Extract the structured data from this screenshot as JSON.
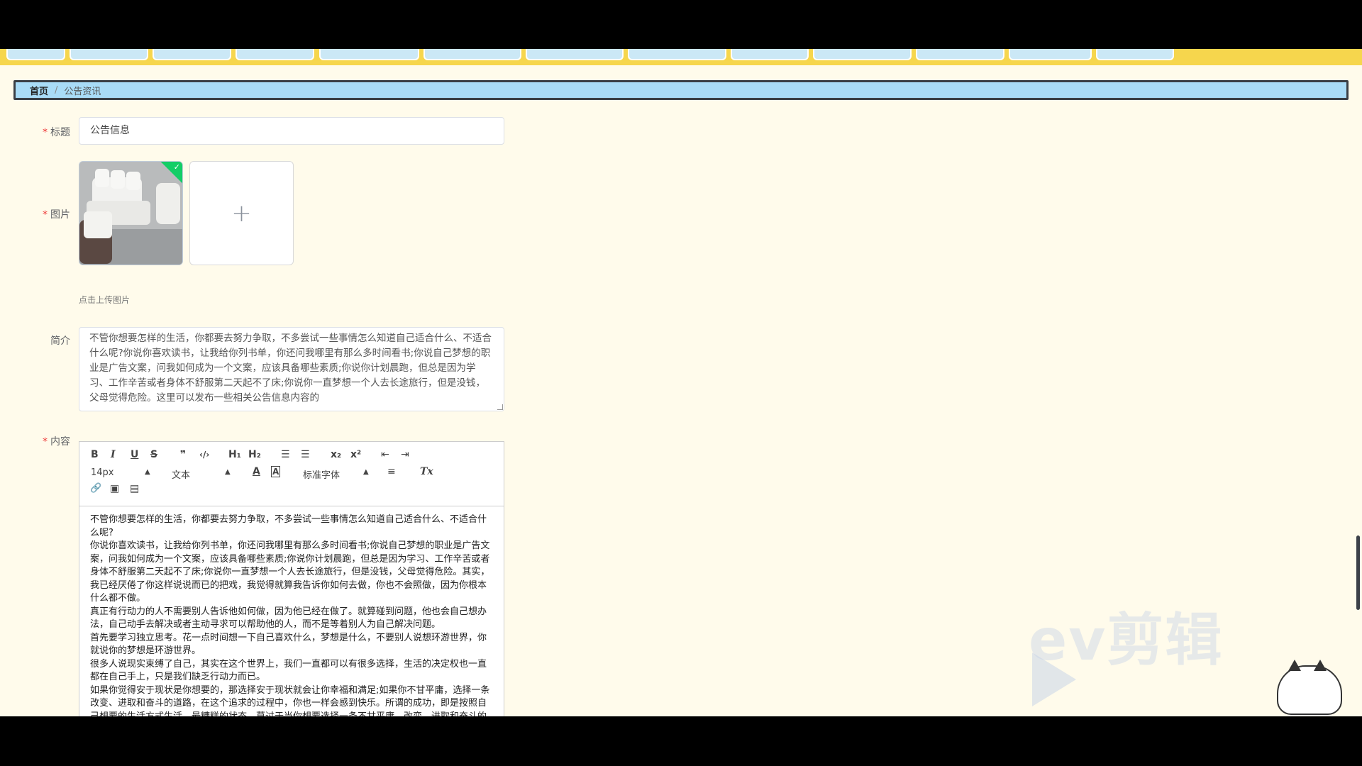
{
  "breadcrumb": {
    "home": "首页",
    "separator": "/",
    "current": "公告资讯"
  },
  "form": {
    "title_label": "标题",
    "title_value": "公告信息",
    "image_label": "图片",
    "upload_tip": "点击上传图片",
    "intro_label": "简介",
    "intro_value": "不管你想要怎样的生活，你都要去努力争取，不多尝试一些事情怎么知道自己适合什么、不适合什么呢?你说你喜欢读书，让我给你列书单，你还问我哪里有那么多时间看书;你说自己梦想的职业是广告文案，问我如何成为一个文案，应该具备哪些素质;你说你计划晨跑，但总是因为学习、工作辛苦或者身体不舒服第二天起不了床;你说你一直梦想一个人去长途旅行，但是没钱，父母觉得危险。这里可以发布一些相关公告信息内容的",
    "content_label": "内容"
  },
  "editor": {
    "toolbar": {
      "bold": "B",
      "italic": "I",
      "underline": "U",
      "strike": "S",
      "quote": "❞",
      "code": "‹/›",
      "h1": "H₁",
      "h2": "H₂",
      "ordered_list": "☰",
      "bullet_list": "☰",
      "sub": "x₂",
      "sup": "x²",
      "outdent": "⇤",
      "indent": "⇥",
      "size": "14px",
      "header": "文本",
      "font": "标准字体",
      "color": "A",
      "background": "A",
      "align": "≡",
      "clean": "Tx",
      "link": "🔗",
      "image": "▣",
      "video": "▤"
    },
    "paragraphs": [
      "不管你想要怎样的生活，你都要去努力争取，不多尝试一些事情怎么知道自己适合什么、不适合什么呢?",
      "你说你喜欢读书，让我给你列书单，你还问我哪里有那么多时间看书;你说自己梦想的职业是广告文案，问我如何成为一个文案，应该具备哪些素质;你说你计划晨跑，但总是因为学习、工作辛苦或者身体不舒服第二天起不了床;你说你一直梦想一个人去长途旅行，但是没钱，父母觉得危险。其实，我已经厌倦了你这样说说而已的把戏，我觉得就算我告诉你如何去做，你也不会照做，因为你根本什么都不做。",
      "真正有行动力的人不需要别人告诉他如何做，因为他已经在做了。就算碰到问题，他也会自己想办法，自己动手去解决或者主动寻求可以帮助他的人，而不是等着别人为自己解决问题。",
      "首先要学习独立思考。花一点时间想一下自己喜欢什么，梦想是什么，不要别人说想环游世界，你就说你的梦想是环游世界。",
      "很多人说现实束缚了自己，其实在这个世界上，我们一直都可以有很多选择，生活的决定权也一直都在自己手上，只是我们缺乏行动力而已。",
      "如果你觉得安于现状是你想要的，那选择安于现状就会让你幸福和满足;如果你不甘平庸，选择一条改变、进取和奋斗的道路，在这个追求的过程中，你也一样会感到快乐。所谓的成功，即是按照自己想要的生活方式生活。最糟糕的状态，莫过于当你想要选择一条不甘平庸、改变、进取和奋斗的"
    ]
  },
  "watermark": {
    "text": "ev剪辑"
  }
}
